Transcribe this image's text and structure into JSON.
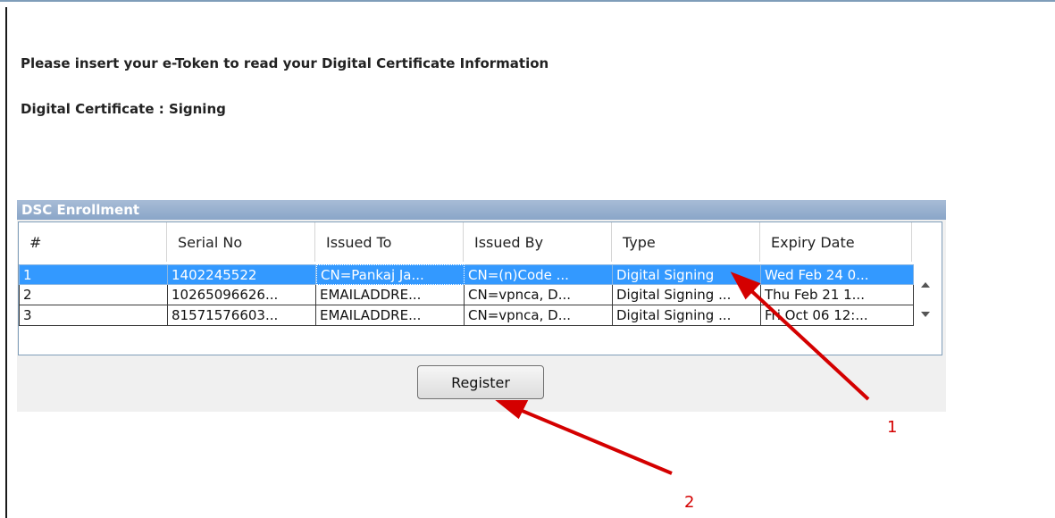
{
  "messages": {
    "insert_token": "Please insert your e-Token to read your Digital Certificate Information",
    "certificate_type": "Digital Certificate : Signing"
  },
  "panel": {
    "title": "DSC Enrollment",
    "columns": [
      "#",
      "Serial No",
      "Issued To",
      "Issued By",
      "Type",
      "Expiry Date"
    ],
    "rows": [
      {
        "num": "1",
        "serial": "1402245522",
        "issued_to": "CN=Pankaj Ja...",
        "issued_by": "CN=(n)Code ...",
        "type": "Digital Signing",
        "expiry": "Wed Feb 24 0...",
        "selected": true
      },
      {
        "num": "2",
        "serial": "10265096626...",
        "issued_to": "EMAILADDRE...",
        "issued_by": "CN=vpnca, D...",
        "type": "Digital Signing ...",
        "expiry": "Thu Feb 21 1...",
        "selected": false
      },
      {
        "num": "3",
        "serial": "81571576603...",
        "issued_to": "EMAILADDRE...",
        "issued_by": "CN=vpnca, D...",
        "type": "Digital Signing ...",
        "expiry": "Fri Oct 06 12:...",
        "selected": false
      }
    ],
    "register_label": "Register"
  },
  "annotations": {
    "marker_1": "1",
    "marker_2": "2",
    "color": "#d40000"
  },
  "colors": {
    "selection": "#3399ff",
    "header_bar": "#8aa6c8"
  }
}
